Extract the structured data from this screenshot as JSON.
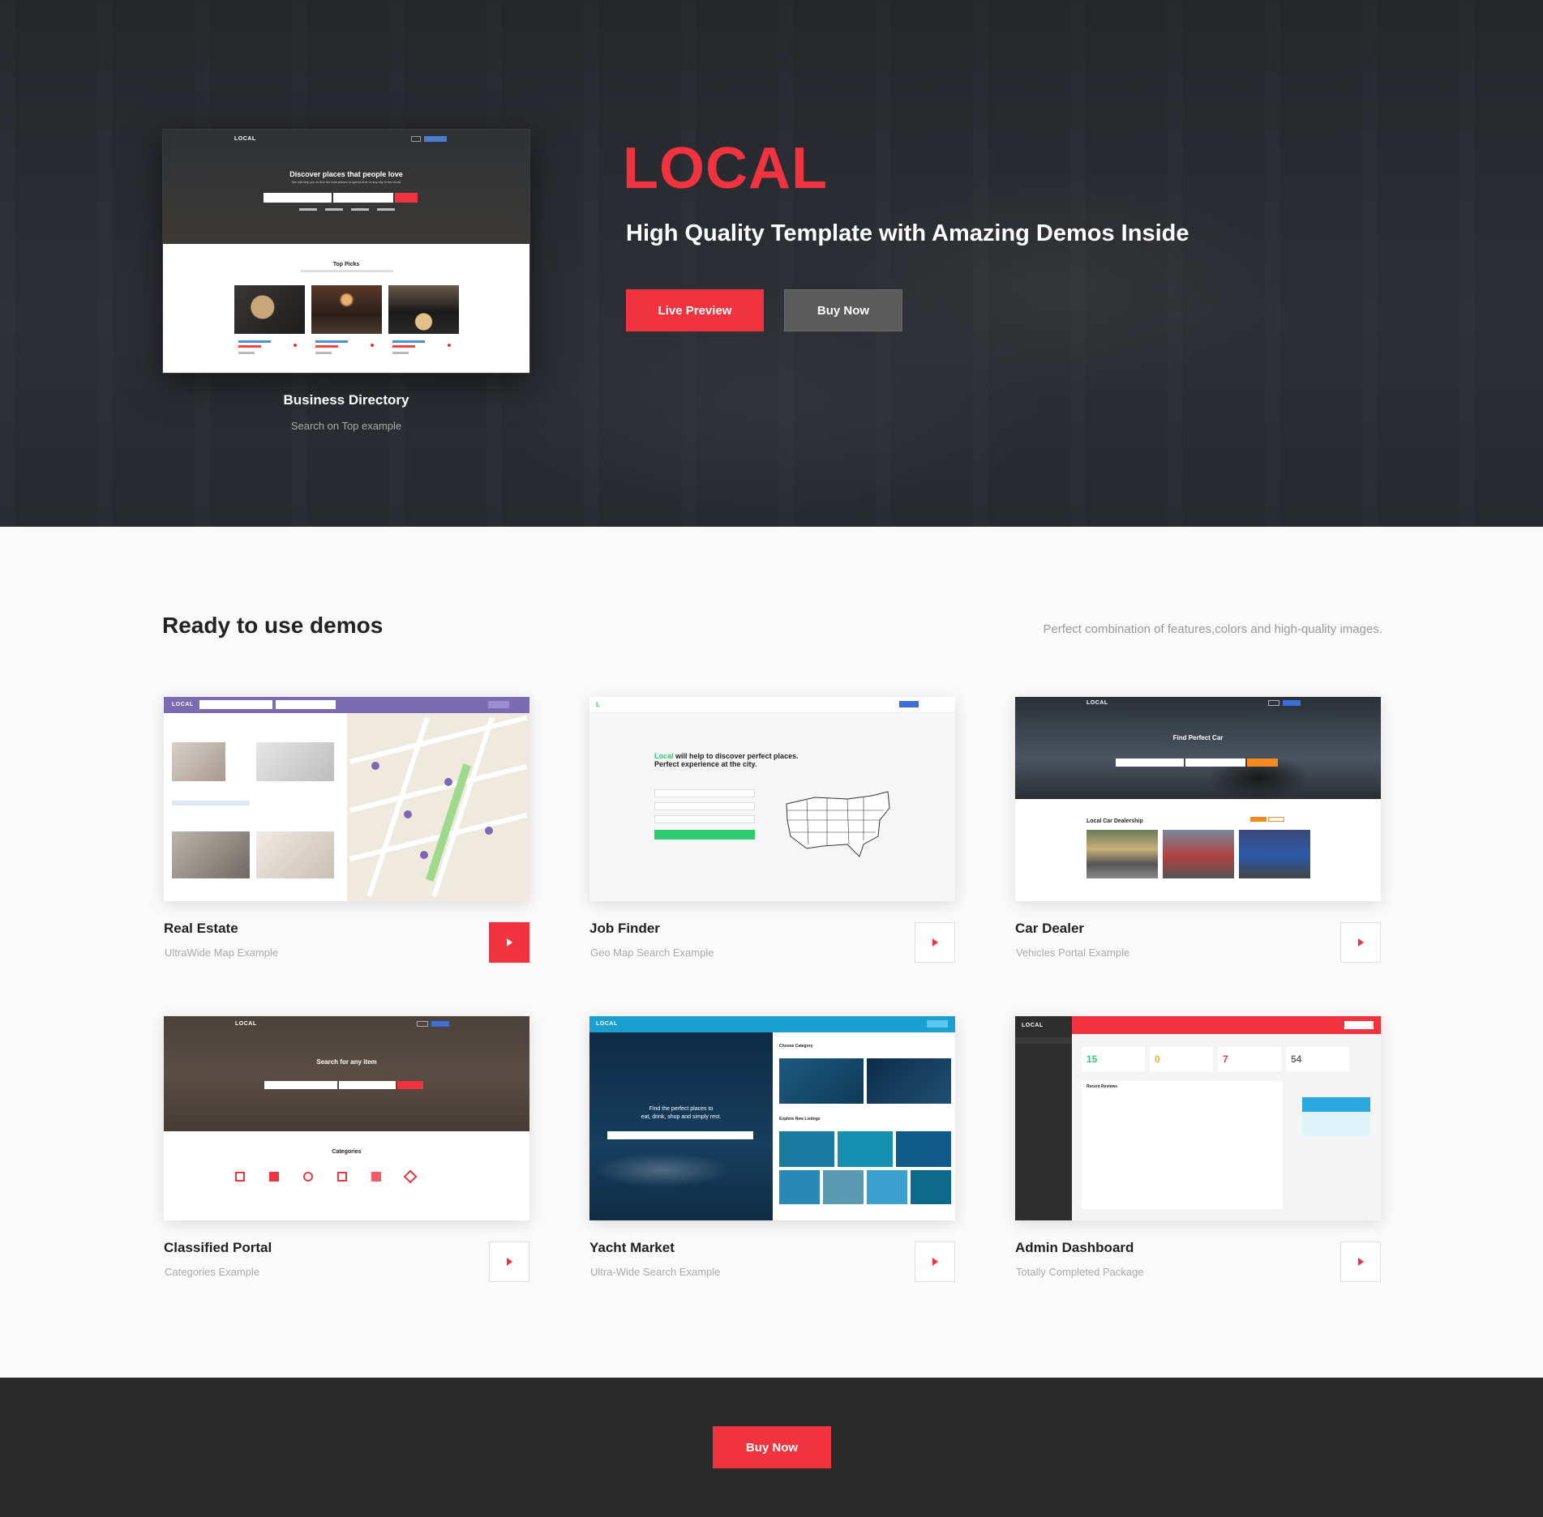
{
  "hero": {
    "brand": "LOCAL",
    "tagline": "High Quality Template with Amazing Demos Inside",
    "live_preview_label": "Live Preview",
    "buy_now_label": "Buy Now",
    "featured": {
      "title": "Business Directory",
      "subtitle": "Search on Top example",
      "screenshot": {
        "logo": "LOCAL",
        "headline": "Discover places that people love",
        "subheadline": "We will help you to find the best places to spend time in any city in the world",
        "section_title": "Top Picks"
      }
    }
  },
  "demos": {
    "title": "Ready to use demos",
    "subtitle": "Perfect combination of features,colors and high-quality images.",
    "items": [
      {
        "title": "Real Estate",
        "subtitle": "UltraWide Map Example",
        "shot_logo": "LOCAL"
      },
      {
        "title": "Job Finder",
        "subtitle": "Geo Map Search Example",
        "shot_heading_1": "Local",
        "shot_heading_2": "will help to discover perfect places.",
        "shot_heading_3": "Perfect experience at the city."
      },
      {
        "title": "Car Dealer",
        "subtitle": "Vehicles Portal Example",
        "shot_logo": "LOCAL",
        "shot_headline": "Find Perfect Car",
        "shot_section": "Local Car Dealership"
      },
      {
        "title": "Classified Portal",
        "subtitle": "Categories Example",
        "shot_logo": "LOCAL",
        "shot_headline": "Search for any item",
        "shot_section": "Categories"
      },
      {
        "title": "Yacht Market",
        "subtitle": "Ultra-Wide Search Example",
        "shot_logo": "LOCAL",
        "shot_headline_1": "Find the perfect places to",
        "shot_headline_2": "eat, drink, shop and simply rest.",
        "shot_section_1": "Choose Category",
        "shot_section_2": "Explore New Listings"
      },
      {
        "title": "Admin Dashboard",
        "subtitle": "Totally Completed Package",
        "shot_logo": "LOCAL",
        "shot_section": "Recent Reviews",
        "stats": [
          "15",
          "0",
          "7",
          "54"
        ]
      }
    ]
  },
  "footer": {
    "buy_now_label": "Buy Now"
  },
  "colors": {
    "accent": "#f0333e",
    "dark": "#2b2b2b",
    "gray_button": "#5b5b5c"
  },
  "icons": {
    "play": "play-icon"
  }
}
